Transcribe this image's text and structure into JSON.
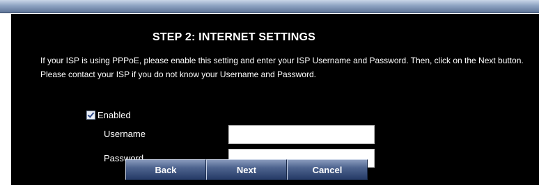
{
  "wizard": {
    "title": "STEP 2: INTERNET SETTINGS",
    "description": "If your ISP is using PPPoE, please enable this setting and enter your ISP Username and Password. Then, click on the Next button. Please contact your ISP if you do not know your Username and Password."
  },
  "form": {
    "enabled": {
      "label": "Enabled",
      "checked": true
    },
    "username": {
      "label": "Username",
      "value": ""
    },
    "password": {
      "label": "Password",
      "value": ""
    }
  },
  "buttons": {
    "back": "Back",
    "next": "Next",
    "cancel": "Cancel"
  },
  "colors": {
    "panel_background": "#000000",
    "text": "#ffffff",
    "button_gradient_top": "#8a9bbd",
    "button_gradient_bottom": "#253a66"
  }
}
